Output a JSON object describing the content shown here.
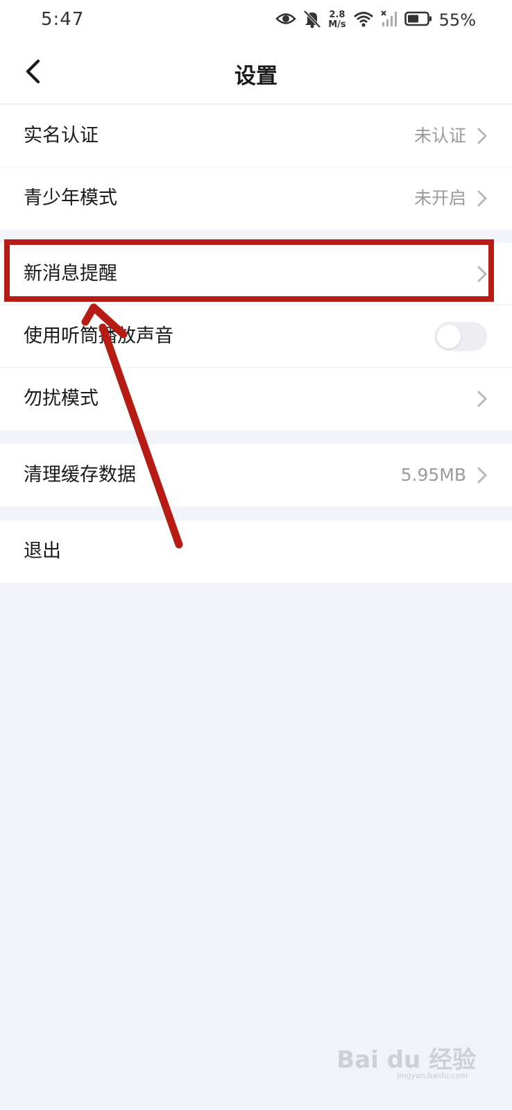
{
  "status_bar": {
    "time": "5:47",
    "speed_value": "2.8",
    "speed_unit": "M/s",
    "battery": "55%",
    "icons": [
      "eye-icon",
      "bell-off-icon",
      "wifi-icon",
      "signal-icon",
      "battery-icon"
    ]
  },
  "header": {
    "title": "设置"
  },
  "groups": [
    {
      "items": [
        {
          "label": "实名认证",
          "value": "未认证",
          "control": "chevron"
        },
        {
          "label": "青少年模式",
          "value": "未开启",
          "control": "chevron"
        }
      ]
    },
    {
      "items": [
        {
          "label": "新消息提醒",
          "value": "",
          "control": "chevron"
        },
        {
          "label": "使用听筒播放声音",
          "value": "",
          "control": "toggle",
          "toggle_on": false
        },
        {
          "label": "勿扰模式",
          "value": "",
          "control": "chevron"
        }
      ]
    },
    {
      "items": [
        {
          "label": "清理缓存数据",
          "value": "5.95MB",
          "control": "chevron"
        }
      ]
    },
    {
      "items": [
        {
          "label": "退出",
          "value": "",
          "control": "none"
        }
      ]
    }
  ],
  "annotation": {
    "color": "#b71c14",
    "highlighted_item": "新消息提醒"
  },
  "watermark": {
    "text": "Bai du 经验",
    "sub": "jingyan.baidu.com"
  },
  "colors": {
    "background": "#f2f3f8",
    "card": "#ffffff",
    "secondary_text": "#9a9a9f",
    "annotation_red": "#b71c14"
  }
}
